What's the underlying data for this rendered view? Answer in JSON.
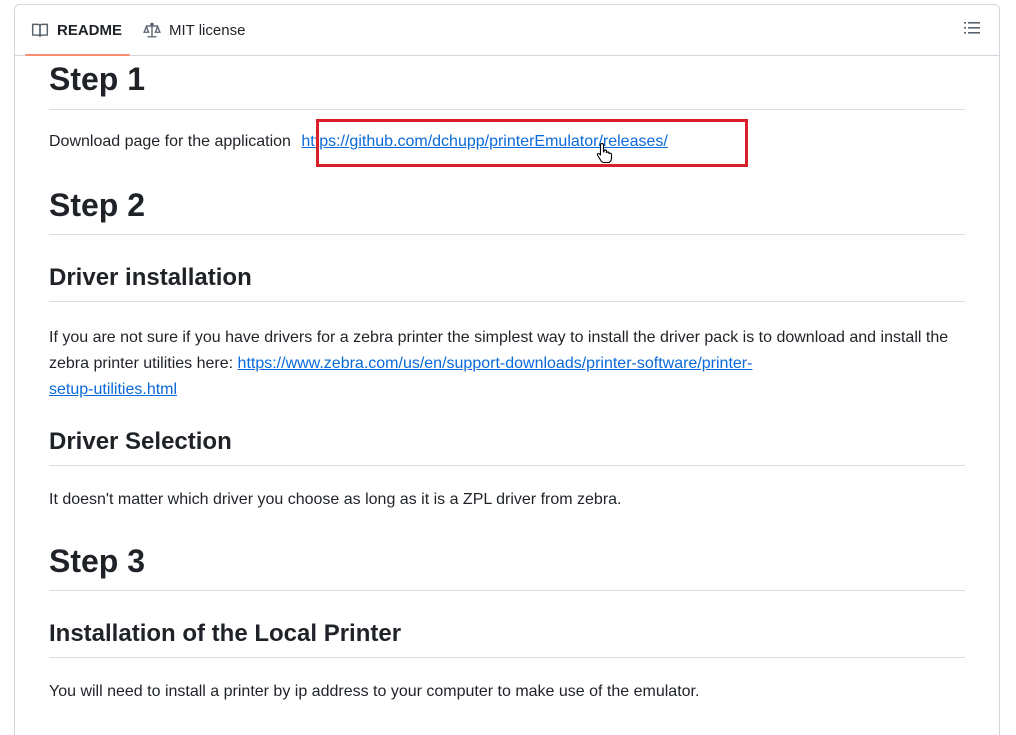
{
  "tabs": {
    "readme_label": "README",
    "license_label": "MIT license"
  },
  "content": {
    "step1": {
      "heading": "Step 1",
      "text": "Download page for the application",
      "link": "https://github.com/dchupp/printerEmulator/releases/"
    },
    "step2": {
      "heading": "Step 2",
      "driver_installation": {
        "heading": "Driver installation",
        "text": "If you are not sure if you have drivers for a zebra printer the simplest way to install the driver pack is to download and install the zebra printer utilities here:",
        "link_line1": "https://www.zebra.com/us/en/support-downloads/printer-software/printer-",
        "link_line2": "setup-utilities.html"
      },
      "driver_selection": {
        "heading": "Driver Selection",
        "text": "It doesn't matter which driver you choose as long as it is a ZPL driver from zebra."
      }
    },
    "step3": {
      "heading": "Step 3",
      "local_printer": {
        "heading": "Installation of the Local Printer",
        "text": "You will need to install a printer by ip address to your computer to make use of the emulator."
      }
    }
  },
  "colors": {
    "link": "#0969da",
    "highlight_box": "#d9202a",
    "tab_underline": "#fd8c73"
  },
  "icons": {
    "readme_tab": "book-icon",
    "license_tab": "law-scale-icon",
    "toc": "list-icon",
    "cursor": "hand-pointer-icon"
  }
}
